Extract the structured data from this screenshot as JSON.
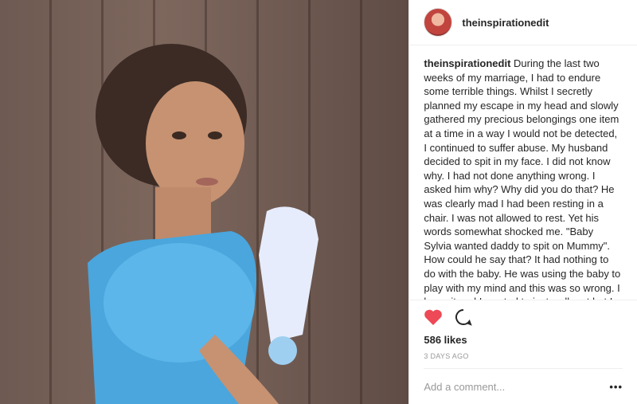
{
  "post": {
    "username": "theinspirationedit",
    "caption_user": "theinspirationedit",
    "caption_text": "During the last two weeks of my marriage, I had to endure some terrible things. Whilst I secretly planned my escape in my head and slowly gathered my precious belongings one item at a time in a way I would not be detected, I continued to suffer abuse. My husband decided to spit in my face. I did not know why. I had not done anything wrong. I asked him why? Why did you do that? He was clearly mad I had been resting in a chair. I was not allowed to rest. Yet his words somewhat shocked me. \"Baby Sylvia wanted daddy to spit on Mummy\". How could he say that? It had nothing to do with the baby. He was using the baby to play with my mind and this was so wrong. I knew it and I wanted to just walk out but I could not. I was distraught but unable to leave. I continued to plan mine and Sylvia's",
    "likes": "586 likes",
    "time_ago": "3 DAYS AGO",
    "comment_placeholder": "Add a comment...",
    "more": "•••"
  },
  "icons": {
    "like": "heart-icon",
    "comment": "comment-icon",
    "options": "more-options-icon"
  },
  "colors": {
    "like": "#ed4956",
    "text": "#262626",
    "muted": "#999999",
    "border": "#efefef"
  }
}
